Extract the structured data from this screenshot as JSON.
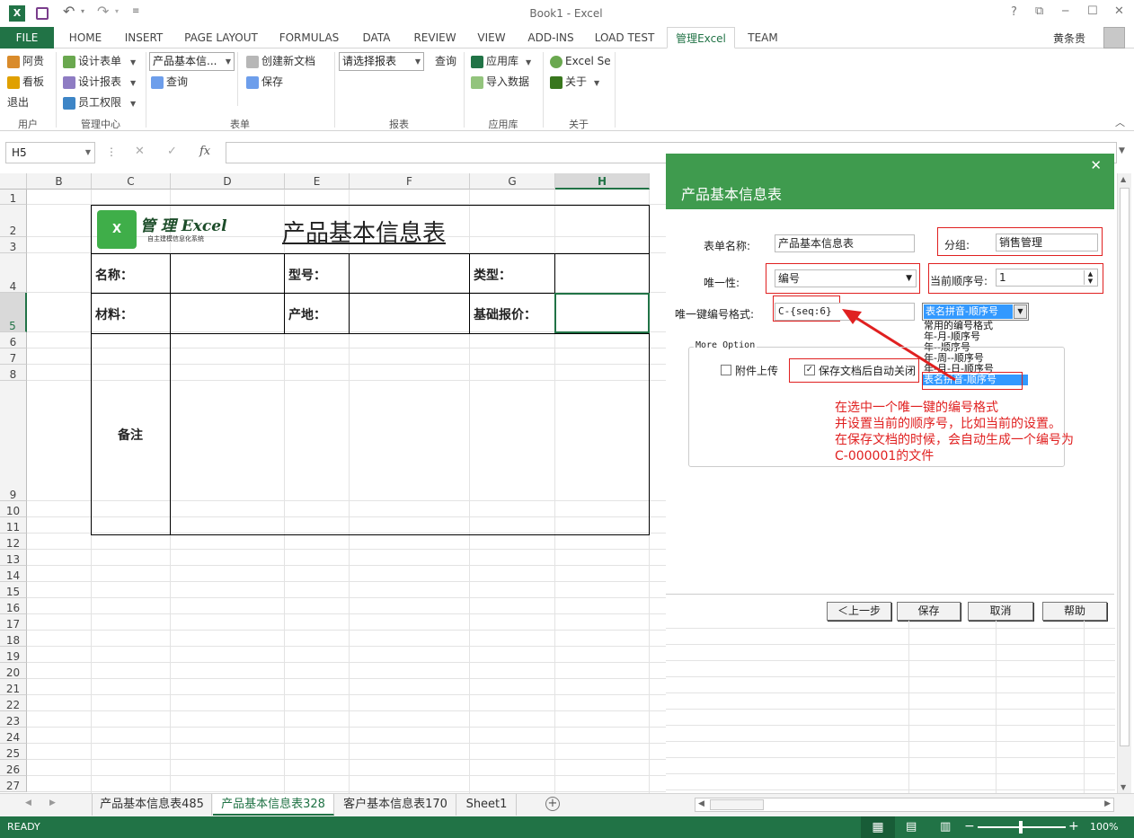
{
  "titlebar": {
    "title": "Book1 - Excel",
    "help": "?",
    "restore": "⧉",
    "minimize": "─",
    "maximize": "☐",
    "close": "✕"
  },
  "tabs": [
    "FILE",
    "HOME",
    "INSERT",
    "PAGE LAYOUT",
    "FORMULAS",
    "DATA",
    "REVIEW",
    "VIEW",
    "ADD-INS",
    "LOAD TEST",
    "管理Excel",
    "TEAM"
  ],
  "user": "黄条贵",
  "ribbon": {
    "user_group": {
      "items": [
        "阿贵",
        "看板",
        "退出"
      ],
      "label": "用户"
    },
    "manage_group": {
      "items": [
        "设计表单",
        "设计报表",
        "员工权限"
      ],
      "label": "管理中心"
    },
    "form_group": {
      "dropdown": "产品基本信...",
      "create": "创建新文档",
      "query": "查询",
      "save": "保存",
      "label": "表单"
    },
    "report_group": {
      "dropdown": "请选择报表",
      "query": "查询",
      "label": "报表"
    },
    "app_group": {
      "items": [
        "应用库",
        "导入数据"
      ],
      "label": "应用库"
    },
    "about_group": {
      "items": [
        "Excel Se",
        "关于"
      ],
      "label": "关于"
    }
  },
  "formula_bar": {
    "name_box": "H5",
    "cancel": "✕",
    "enter": "✓",
    "fx": "fx",
    "formula": ""
  },
  "columns": [
    "B",
    "C",
    "D",
    "E",
    "F",
    "G",
    "H"
  ],
  "rows": [
    "1",
    "2",
    "3",
    "4",
    "5",
    "6",
    "7",
    "8",
    "9",
    "10",
    "11",
    "12",
    "13",
    "14",
    "15",
    "16",
    "17",
    "18",
    "19",
    "20",
    "21",
    "22",
    "23",
    "24",
    "25",
    "26",
    "27"
  ],
  "sheet": {
    "logo_text": "管 理 Excel",
    "logo_sub": "自主建模信息化系统",
    "title": "产品基本信息表",
    "labels": {
      "name": "名称：",
      "model": "型号：",
      "type": "类型：",
      "material": "材料：",
      "origin": "产地：",
      "price": "基础报价：",
      "remark": "备注"
    }
  },
  "dialog": {
    "title": "产品基本信息表",
    "close": "✕",
    "form_name_label": "表单名称:",
    "form_name_value": "产品基本信息表",
    "group_label": "分组:",
    "group_value": "销售管理",
    "unique_label": "唯一性:",
    "unique_value": "编号",
    "seq_label": "当前顺序号:",
    "seq_value": "1",
    "format_label": "唯一键编号格式:",
    "format_value": "C-{seq:6}",
    "format_select": "表名拼音-顺序号",
    "format_options": [
      "常用的编号格式",
      "年-月-顺序号",
      "年--顺序号",
      "年-周--顺序号",
      "年-月-日-顺序号",
      "表名拼音-顺序号"
    ],
    "more_option": "More Option",
    "attach_upload": "附件上传",
    "auto_close": "保存文档后自动关闭",
    "note": [
      "在选中一个唯一键的编号格式",
      "并设置当前的顺序号，比如当前的设置。",
      "在保存文档的时候，会自动生成一个编号为",
      "C-000001的文件"
    ],
    "buttons": {
      "prev": "＜上一步",
      "save": "保存",
      "cancel": "取消",
      "help": "帮助"
    }
  },
  "sheet_tabs": [
    "产品基本信息表485",
    "产品基本信息表328",
    "客户基本信息表170",
    "Sheet1"
  ],
  "status": {
    "ready": "READY",
    "zoom": "100%"
  },
  "colors": {
    "excel_green": "#217346",
    "dialog_green": "#3f9b4e",
    "annotation_red": "#e02020"
  }
}
